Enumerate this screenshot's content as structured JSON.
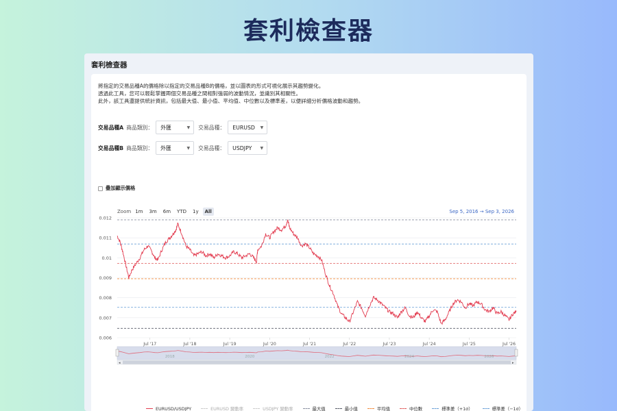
{
  "page": {
    "hero_title": "套利檢查器"
  },
  "window": {
    "title": "套利檢查器"
  },
  "description": [
    "將指定的交易品種A的價格除以指定的交易品種B的價格，並以圖表的形式可視化展示其趨勢變化。",
    "透過此工具，您可以輕鬆掌握兩個交易品種之間相對強弱的波動情況，並識別其相關性。",
    "此外，該工具還提供統計資訊，包括最大值、最小值、平均值、中位數以及標準差，以便詳細分析價格波動和趨勢。"
  ],
  "symbol_a": {
    "label": "交易品種A",
    "category_label": "商品類別：",
    "category_value": "外匯",
    "symbol_label": "交易品種：",
    "symbol_value": "EURUSD"
  },
  "symbol_b": {
    "label": "交易品種B",
    "category_label": "商品類別：",
    "category_value": "外匯",
    "symbol_label": "交易品種：",
    "symbol_value": "USDJPY"
  },
  "overlay_checkbox": {
    "label": "疊加顯示價格",
    "checked": false
  },
  "zoom": {
    "label": "Zoom",
    "buttons": [
      {
        "label": "1m",
        "active": false
      },
      {
        "label": "3m",
        "active": false
      },
      {
        "label": "6m",
        "active": false
      },
      {
        "label": "YTD",
        "active": false
      },
      {
        "label": "1y",
        "active": false
      },
      {
        "label": "All",
        "active": true
      }
    ]
  },
  "date_range": {
    "from": "Sep 5, 2016",
    "arrow": "→",
    "to": "Sep 3, 2026"
  },
  "chart_data": {
    "type": "line",
    "title": "",
    "xlabel": "",
    "ylabel": "",
    "ylim": [
      0.006,
      0.012
    ],
    "y_ticks": [
      "0.012",
      "0.011",
      "0.01",
      "0.009",
      "0.008",
      "0.007",
      "0.006"
    ],
    "x_ticks": [
      "Jul '17",
      "Jul '18",
      "Jul '19",
      "Jul '20",
      "Jul '21",
      "Jul '22",
      "Jul '23",
      "Jul '24",
      "Jul '25",
      "Jul '26"
    ],
    "navigator_ticks": [
      "2018",
      "2020",
      "2022",
      "2024",
      "2026"
    ],
    "series": [
      {
        "name": "EURUSD/USDJPY",
        "color": "#e23a4e",
        "x": [
          2016.68,
          2016.75,
          2016.82,
          2016.9,
          2016.97,
          2017.05,
          2017.15,
          2017.25,
          2017.35,
          2017.45,
          2017.55,
          2017.62,
          2017.7,
          2017.8,
          2017.9,
          2018.0,
          2018.08,
          2018.15,
          2018.2,
          2018.3,
          2018.4,
          2018.5,
          2018.6,
          2018.7,
          2018.8,
          2018.9,
          2019.0,
          2019.1,
          2019.2,
          2019.3,
          2019.4,
          2019.5,
          2019.6,
          2019.7,
          2019.8,
          2019.9,
          2020.0,
          2020.1,
          2020.17,
          2020.2,
          2020.3,
          2020.4,
          2020.5,
          2020.6,
          2020.7,
          2020.8,
          2020.9,
          2020.95,
          2021.0,
          2021.1,
          2021.2,
          2021.3,
          2021.4,
          2021.5,
          2021.6,
          2021.7,
          2021.8,
          2021.9,
          2022.0,
          2022.1,
          2022.2,
          2022.3,
          2022.4,
          2022.5,
          2022.6,
          2022.7,
          2022.8,
          2022.9,
          2023.0,
          2023.1,
          2023.2,
          2023.3,
          2023.4,
          2023.5,
          2023.6,
          2023.7,
          2023.8,
          2023.9,
          2024.0,
          2024.1,
          2024.2,
          2024.3,
          2024.4,
          2024.5,
          2024.6,
          2024.7,
          2024.8,
          2024.9,
          2025.0,
          2025.1,
          2025.2,
          2025.3,
          2025.4,
          2025.5,
          2025.6,
          2025.7,
          2025.8,
          2025.9,
          2026.0,
          2026.1,
          2026.2,
          2026.3,
          2026.4,
          2026.5,
          2026.6,
          2026.68
        ],
        "y": [
          0.0111,
          0.0108,
          0.0103,
          0.0096,
          0.009,
          0.0094,
          0.0097,
          0.01,
          0.0104,
          0.0106,
          0.0103,
          0.01,
          0.0099,
          0.0104,
          0.0108,
          0.011,
          0.0112,
          0.0114,
          0.0117,
          0.0112,
          0.0106,
          0.0104,
          0.0101,
          0.0102,
          0.0103,
          0.0101,
          0.0102,
          0.01,
          0.0102,
          0.0101,
          0.01,
          0.0101,
          0.0103,
          0.0102,
          0.01,
          0.0101,
          0.0102,
          0.01,
          0.0098,
          0.0104,
          0.0106,
          0.0112,
          0.011,
          0.0113,
          0.0115,
          0.0114,
          0.0116,
          0.0119,
          0.0115,
          0.0112,
          0.011,
          0.0106,
          0.0107,
          0.0105,
          0.0102,
          0.0101,
          0.0099,
          0.0092,
          0.0086,
          0.0082,
          0.0076,
          0.0072,
          0.007,
          0.0068,
          0.0073,
          0.0078,
          0.0075,
          0.0071,
          0.0076,
          0.008,
          0.0079,
          0.0077,
          0.0075,
          0.0073,
          0.0072,
          0.007,
          0.0073,
          0.0075,
          0.0071,
          0.007,
          0.0073,
          0.007,
          0.0068,
          0.0071,
          0.0074,
          0.0073,
          0.0067,
          0.0069,
          0.0073,
          0.0077,
          0.0079,
          0.0078,
          0.0075,
          0.0077,
          0.0076,
          0.0078,
          0.0077,
          0.0074,
          0.0073,
          0.0075,
          0.0072,
          0.0073,
          0.0071,
          0.0069,
          0.0072,
          0.0073
        ]
      }
    ],
    "reference_lines": [
      {
        "name": "最大值",
        "value": 0.0119,
        "color": "#8a8fa0"
      },
      {
        "name": "最小值",
        "value": 0.00647,
        "color": "#555a66"
      },
      {
        "name": "平均值",
        "value": 0.00895,
        "color": "#f08a3c"
      },
      {
        "name": "中位數",
        "value": 0.00972,
        "color": "#e05a5a"
      },
      {
        "name": "標準差（+1σ）",
        "value": 0.01069,
        "color": "#6aa0d8"
      },
      {
        "name": "標準差（−1σ）",
        "value": 0.00753,
        "color": "#6aa0d8"
      }
    ],
    "legend": [
      {
        "label": "EURUSD/USDJPY",
        "color": "#e23a4e",
        "style": "solid",
        "enabled": true
      },
      {
        "label": "EURUSD 變動率",
        "color": "#bbbbbb",
        "style": "dashed",
        "enabled": false
      },
      {
        "label": "USDJPY 變動率",
        "color": "#bbbbbb",
        "style": "dashed",
        "enabled": false
      },
      {
        "label": "最大值",
        "color": "#8a8fa0",
        "style": "dashed",
        "enabled": true
      },
      {
        "label": "最小值",
        "color": "#555a66",
        "style": "dashed",
        "enabled": true
      },
      {
        "label": "平均值",
        "color": "#f08a3c",
        "style": "dashed",
        "enabled": true
      },
      {
        "label": "中位數",
        "color": "#e05a5a",
        "style": "dashed",
        "enabled": true
      },
      {
        "label": "標準差（+1σ）",
        "color": "#6aa0d8",
        "style": "dashed",
        "enabled": true
      },
      {
        "label": "標準差（−1σ）",
        "color": "#6aa0d8",
        "style": "dashed",
        "enabled": true
      }
    ],
    "grid": true,
    "legend_position": "bottom"
  }
}
